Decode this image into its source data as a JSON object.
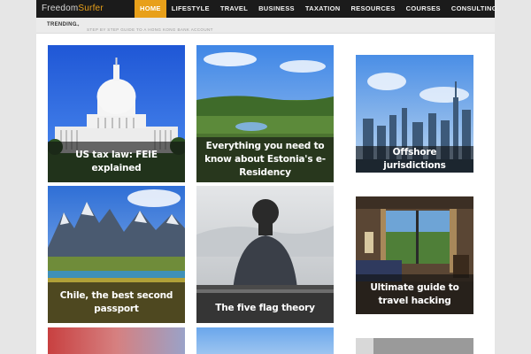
{
  "brand": {
    "logo_part1": "Freedom",
    "logo_part2": "Surfer"
  },
  "nav": {
    "items": [
      "HOME",
      "LIFESTYLE",
      "TRAVEL",
      "BUSINESS",
      "TAXATION",
      "RESOURCES",
      "COURSES",
      "CONSULTING"
    ],
    "active": "HOME"
  },
  "trending": {
    "label": "TRENDING",
    "arrow": "→",
    "text": "STEP BY STEP GUIDE TO A HONG KONG BANK ACCOUNT"
  },
  "articles": [
    {
      "title": "US tax law: FEIE explained"
    },
    {
      "title": "Everything you need to know about Estonia's e-Residency"
    },
    {
      "title": "Offshore jurisdictions"
    },
    {
      "title": "Chile, the best second passport"
    },
    {
      "title": "The five flag theory"
    },
    {
      "title": "Ultimate guide to travel hacking"
    }
  ],
  "colors": {
    "accent": "#e8a01a",
    "navbar": "#1b1b1b",
    "overlay": "rgba(18,18,18,0.62)"
  }
}
